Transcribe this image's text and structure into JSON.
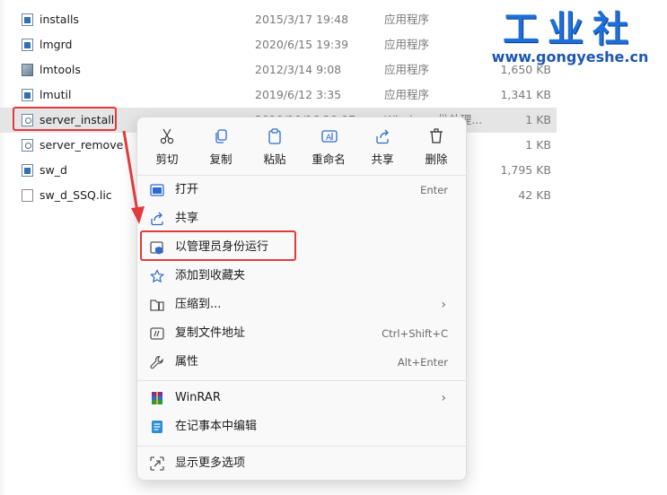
{
  "files": [
    {
      "name": "installs",
      "date": "2015/3/17 19:48",
      "type": "应用程序",
      "size": "",
      "icon": "exe-file-icon"
    },
    {
      "name": "lmgrd",
      "date": "2020/6/15 19:39",
      "type": "应用程序",
      "size": "",
      "icon": "exe-file-icon"
    },
    {
      "name": "lmtools",
      "date": "2012/3/14 9:08",
      "type": "应用程序",
      "size": "1,650 KB",
      "icon": "tools-file-icon"
    },
    {
      "name": "lmutil",
      "date": "2019/6/12 3:35",
      "type": "应用程序",
      "size": "1,341 KB",
      "icon": "exe-file-icon"
    },
    {
      "name": "server_install",
      "date": "2019/10/16 20:07",
      "type": "Windows 批处理...",
      "size": "1 KB",
      "icon": "batch-file-icon",
      "selected": true
    },
    {
      "name": "server_remove",
      "date": "",
      "type": "",
      "size": "1 KB",
      "icon": "batch-file-icon"
    },
    {
      "name": "sw_d",
      "date": "",
      "type": "",
      "size": "1,795 KB",
      "icon": "exe-file-icon"
    },
    {
      "name": "sw_d_SSQ.lic",
      "date": "",
      "type": "",
      "size": "42 KB",
      "icon": "text-file-icon"
    }
  ],
  "context_menu": {
    "top_actions": [
      {
        "label": "剪切",
        "icon": "cut-icon"
      },
      {
        "label": "复制",
        "icon": "copy-icon"
      },
      {
        "label": "粘贴",
        "icon": "paste-icon"
      },
      {
        "label": "重命名",
        "icon": "rename-icon"
      },
      {
        "label": "共享",
        "icon": "share-icon"
      },
      {
        "label": "删除",
        "icon": "delete-icon"
      }
    ],
    "items": {
      "open": {
        "label": "打开",
        "shortcut": "Enter"
      },
      "share": {
        "label": "共享"
      },
      "run_as_admin": {
        "label": "以管理员身份运行"
      },
      "add_favorites": {
        "label": "添加到收藏夹"
      },
      "compress": {
        "label": "压缩到..."
      },
      "copy_path": {
        "label": "复制文件地址",
        "shortcut": "Ctrl+Shift+C"
      },
      "properties": {
        "label": "属性",
        "shortcut": "Alt+Enter"
      },
      "winrar": {
        "label": "WinRAR"
      },
      "edit_notepad": {
        "label": "在记事本中编辑"
      },
      "more_options": {
        "label": "显示更多选项"
      }
    }
  },
  "watermark": {
    "title": "工业社",
    "url": "www.gongyeshe.cn"
  },
  "colors": {
    "highlight": "#e23a3a",
    "accent": "#1e6fd9",
    "selected_row": "#e5e5e5"
  }
}
